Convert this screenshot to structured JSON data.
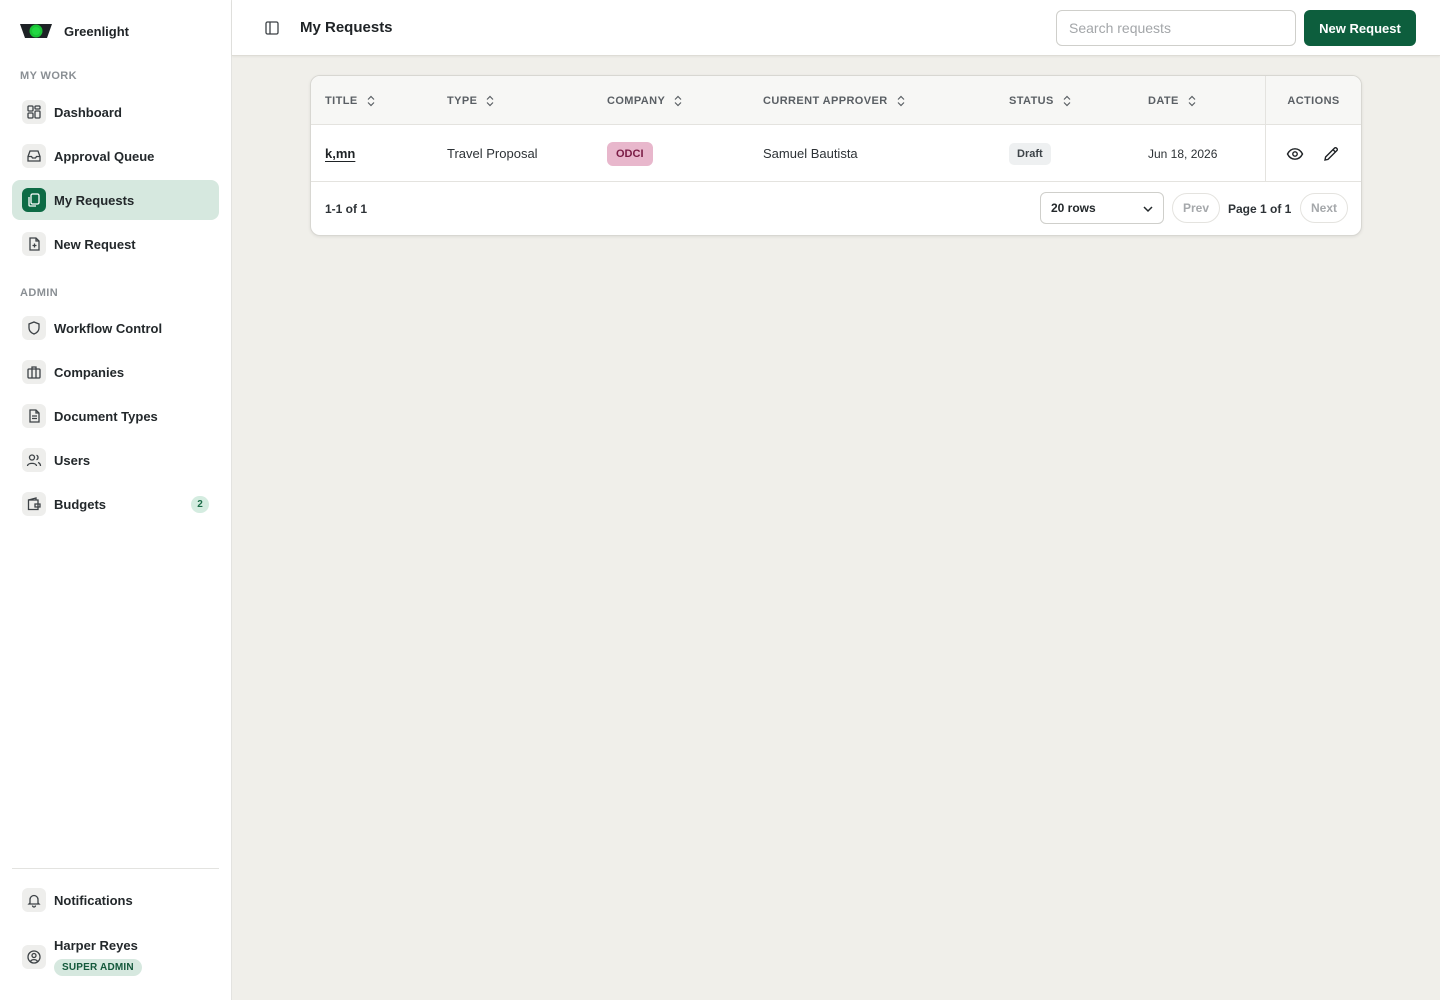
{
  "brand": {
    "name": "Greenlight"
  },
  "sidebar": {
    "sections": [
      {
        "label": "MY WORK",
        "items": [
          {
            "label": "Dashboard",
            "icon": "dashboard-icon"
          },
          {
            "label": "Approval Queue",
            "icon": "inbox-icon"
          },
          {
            "label": "My Requests",
            "icon": "copy-icon",
            "active": true
          },
          {
            "label": "New Request",
            "icon": "file-plus-icon"
          }
        ]
      },
      {
        "label": "ADMIN",
        "items": [
          {
            "label": "Workflow Control",
            "icon": "shield-icon"
          },
          {
            "label": "Companies",
            "icon": "briefcase-icon"
          },
          {
            "label": "Document Types",
            "icon": "document-icon"
          },
          {
            "label": "Users",
            "icon": "users-icon"
          },
          {
            "label": "Budgets",
            "icon": "wallet-icon",
            "badge": "2"
          }
        ]
      }
    ],
    "footer": {
      "notifications_label": "Notifications",
      "user_name": "Harper Reyes",
      "user_role": "SUPER ADMIN"
    }
  },
  "header": {
    "title": "My Requests",
    "search_placeholder": "Search requests",
    "new_request_label": "New Request"
  },
  "table": {
    "columns": [
      "TITLE",
      "TYPE",
      "COMPANY",
      "CURRENT APPROVER",
      "STATUS",
      "DATE"
    ],
    "actions_header": "ACTIONS",
    "rows": [
      {
        "title": "k,mn",
        "type": "Travel Proposal",
        "company": "ODCI",
        "approver": "Samuel Bautista",
        "status": "Draft",
        "date": "Jun 18, 2026"
      }
    ]
  },
  "pagination": {
    "count": "1-1 of 1",
    "rows_per_page": "20 rows",
    "prev_label": "Prev",
    "page_info": "Page 1 of 1",
    "next_label": "Next"
  },
  "colors": {
    "primary": "#0d5e3d",
    "active_nav_bg": "#d6e8df",
    "company_pill_bg": "#e8b7cc",
    "page_bg": "#f0efea"
  }
}
